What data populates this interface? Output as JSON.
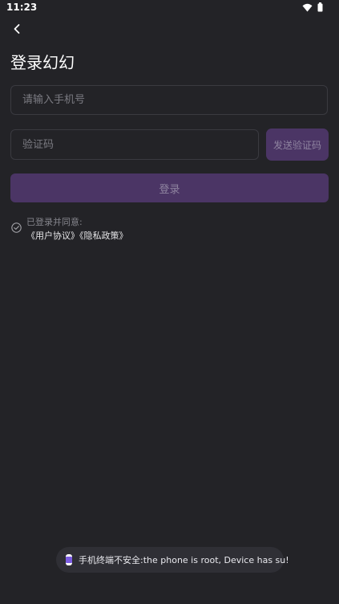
{
  "status_bar": {
    "time": "11:23",
    "icons": [
      "wifi-icon",
      "battery-icon"
    ]
  },
  "header": {
    "back_icon": "back-arrow-icon",
    "title": "登录幻幻"
  },
  "form": {
    "phone_placeholder": "请输入手机号",
    "code_placeholder": "验证码",
    "send_code_label": "发送验证码",
    "login_label": "登录"
  },
  "agreement": {
    "prefix": "已登录并同意:",
    "links": "《用户协议》《隐私政策》"
  },
  "toast": {
    "message": "手机终端不安全:the phone is root, Device has su!"
  },
  "colors": {
    "background": "#232327",
    "accent_disabled": "#4b3565",
    "accent_disabled_text": "#8f84a0",
    "input_border": "#3a3a40"
  }
}
